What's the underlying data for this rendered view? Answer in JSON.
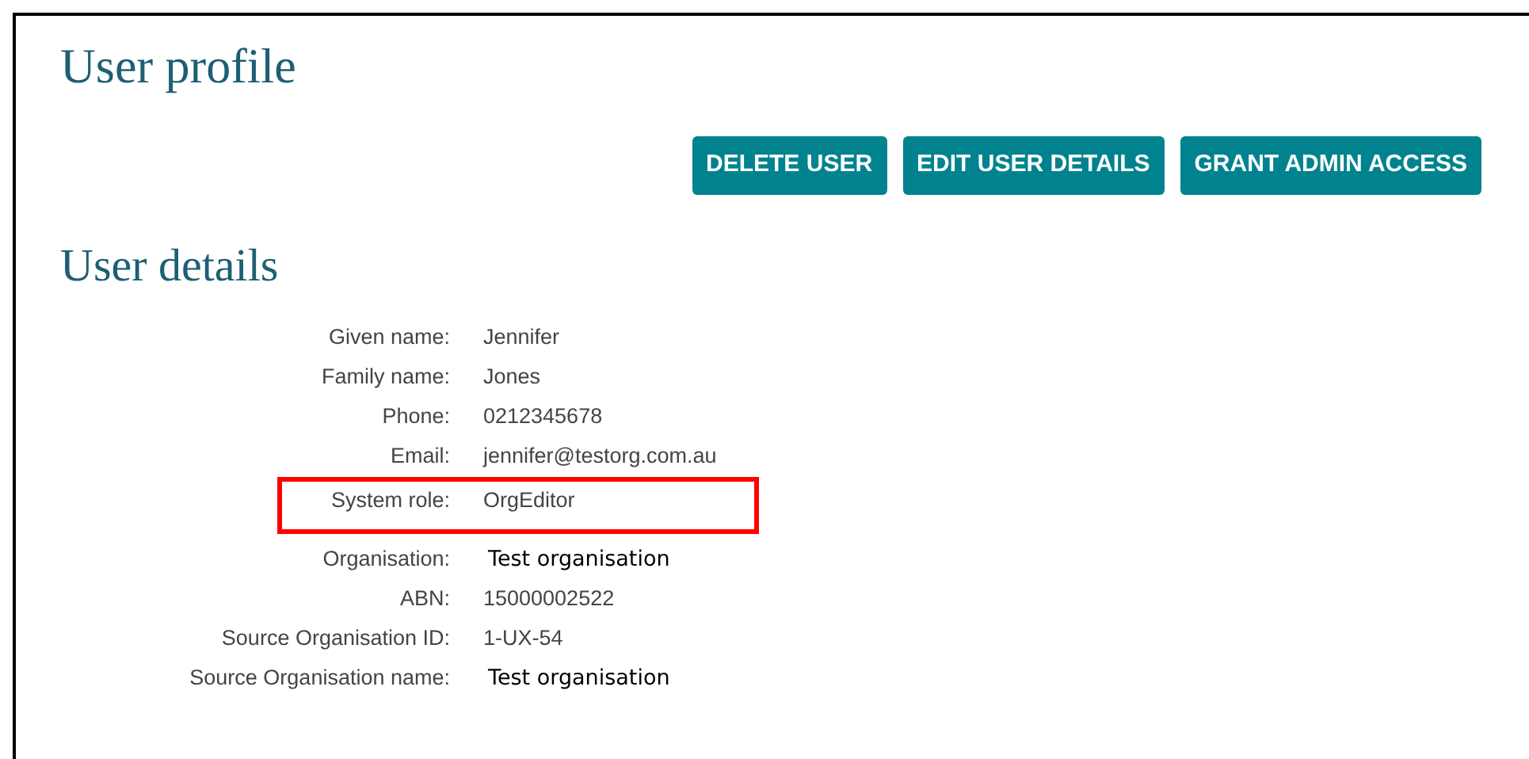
{
  "page_title": "User profile",
  "actions": [
    "DELETE USER",
    "EDIT USER DETAILS",
    "GRANT ADMIN ACCESS"
  ],
  "section_title": "User details",
  "fields": [
    {
      "label": "Given name:",
      "value": "Jennifer",
      "kind": "plain",
      "highlighted": false
    },
    {
      "label": "Family name:",
      "value": "Jones",
      "kind": "plain",
      "highlighted": false
    },
    {
      "label": "Phone:",
      "value": "0212345678",
      "kind": "plain",
      "highlighted": false
    },
    {
      "label": "Email:",
      "value": "jennifer@testorg.com.au",
      "kind": "plain",
      "highlighted": false
    },
    {
      "label": "System role:",
      "value": "OrgEditor",
      "kind": "plain",
      "highlighted": true
    },
    {
      "label": "Organisation:",
      "value": "Test organisation",
      "kind": "alt",
      "highlighted": false
    },
    {
      "label": "ABN:",
      "value": "15000002522",
      "kind": "plain",
      "highlighted": false
    },
    {
      "label": "Source Organisation ID:",
      "value": "1-UX-54",
      "kind": "plain",
      "highlighted": false
    },
    {
      "label": "Source Organisation name:",
      "value": "Test organisation",
      "kind": "alt",
      "highlighted": false
    }
  ]
}
